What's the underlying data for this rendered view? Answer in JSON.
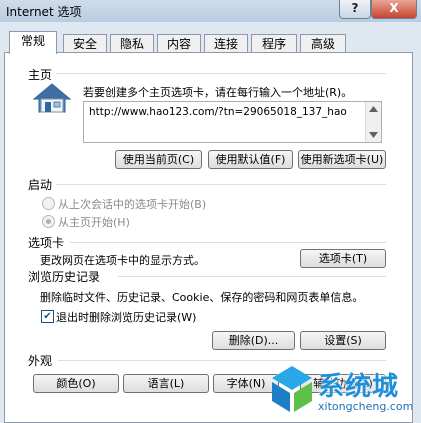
{
  "window": {
    "title": "Internet 选项",
    "help_label": "?",
    "close_label": "X"
  },
  "tabs": [
    "常规",
    "安全",
    "隐私",
    "内容",
    "连接",
    "程序",
    "高级"
  ],
  "home": {
    "section": "主页",
    "instruction": "若要创建多个主页选项卡，请在每行输入一个地址(R)。",
    "url": "http://www.hao123.com/?tn=29065018_137_hao",
    "btn_current": "使用当前页(C)",
    "btn_default": "使用默认值(F)",
    "btn_newtab": "使用新选项卡(U)"
  },
  "startup": {
    "section": "启动",
    "opt_last_session": "从上次会话中的选项卡开始(B)",
    "opt_home": "从主页开始(H)"
  },
  "tabs_section": {
    "section": "选项卡",
    "description": "更改网页在选项卡中的显示方式。",
    "btn": "选项卡(T)"
  },
  "history": {
    "section": "浏览历史记录",
    "description": "删除临时文件、历史记录、Cookie、保存的密码和网页表单信息。",
    "checkbox_label": "退出时删除浏览历史记录(W)",
    "checkbox_checked": true,
    "btn_delete": "删除(D)...",
    "btn_settings": "设置(S)"
  },
  "appearance": {
    "section": "外观",
    "btn_colors": "颜色(O)",
    "btn_languages": "语言(L)",
    "btn_fonts": "字体(N)",
    "btn_accessibility": "辅助功能(E)"
  },
  "watermark": {
    "brand": "系统城",
    "site": "xitongcheng.com"
  }
}
